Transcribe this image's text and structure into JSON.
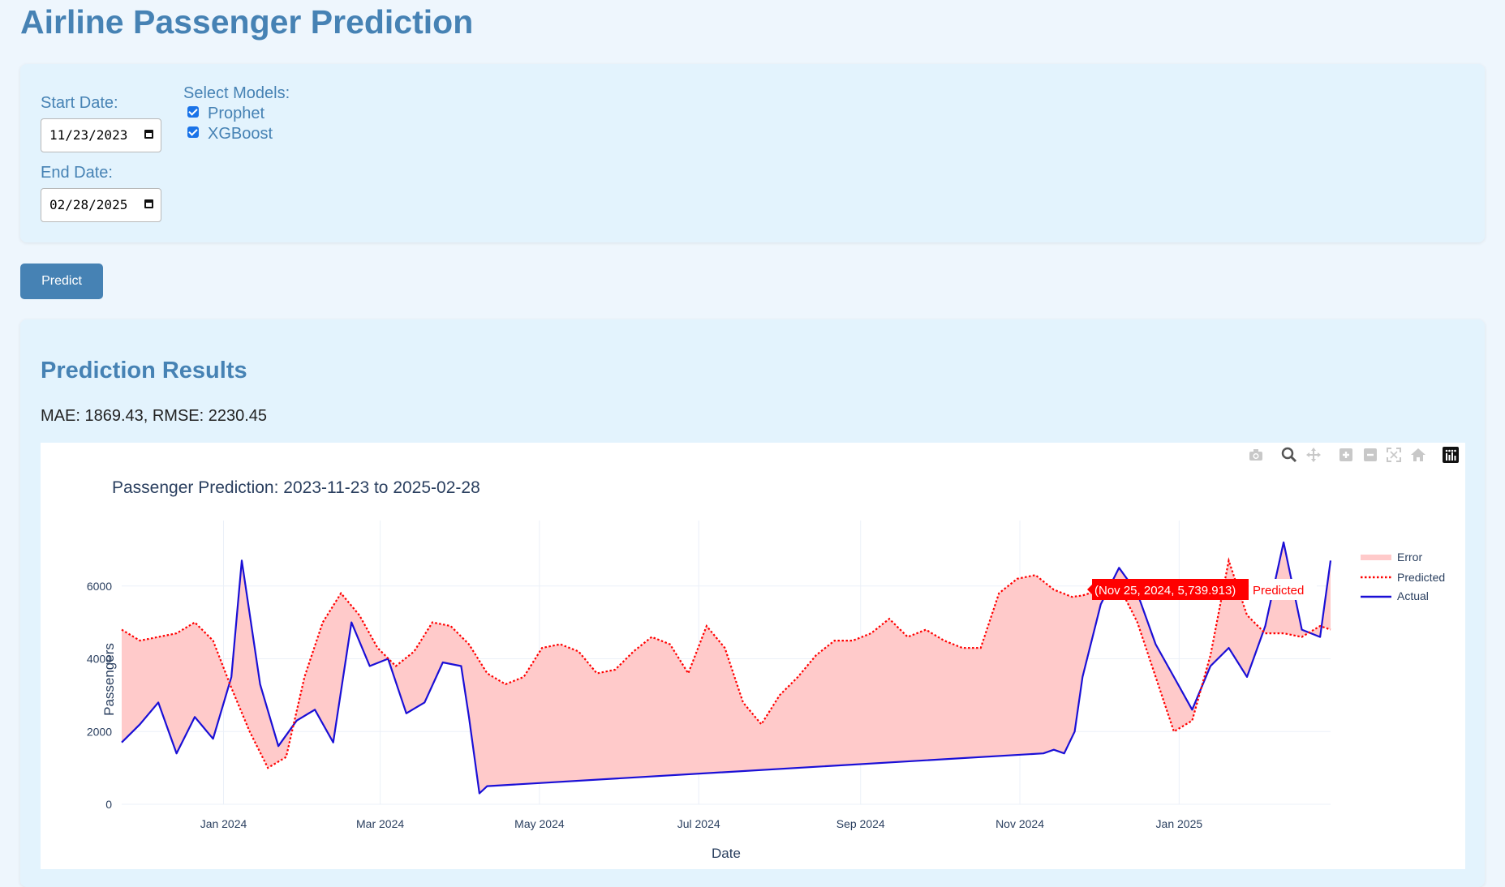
{
  "page": {
    "title": "Airline Passenger Prediction"
  },
  "controls": {
    "start_label": "Start Date:",
    "start_value": "11/23/2023",
    "end_label": "End Date:",
    "end_value": "02/28/2025",
    "models_label": "Select Models:",
    "models": [
      {
        "label": "Prophet",
        "checked": true
      },
      {
        "label": "XGBoost",
        "checked": true
      }
    ],
    "predict_label": "Predict"
  },
  "results": {
    "heading": "Prediction Results",
    "metrics": "MAE: 1869.43, RMSE: 2230.45"
  },
  "toolbar": {
    "icons": [
      "camera-icon",
      "zoom-icon",
      "pan-icon",
      "zoom-in-icon",
      "zoom-out-icon",
      "autoscale-icon",
      "reset-axes-icon",
      "plotly-logo-icon"
    ]
  },
  "tooltip": {
    "text": "(Nov 25, 2024, 5,739.913)",
    "series": "Predicted"
  },
  "chart_data": {
    "type": "line",
    "title": "Passenger Prediction: 2023-11-23 to 2025-02-28",
    "xlabel": "Date",
    "ylabel": "Passengers",
    "x_range": [
      "2023-11-23",
      "2025-02-28"
    ],
    "ylim": [
      0,
      7800
    ],
    "x_ticks": [
      {
        "date": "2024-01-01",
        "label": "Jan 2024"
      },
      {
        "date": "2024-03-01",
        "label": "Mar 2024"
      },
      {
        "date": "2024-05-01",
        "label": "May 2024"
      },
      {
        "date": "2024-07-01",
        "label": "Jul 2024"
      },
      {
        "date": "2024-09-01",
        "label": "Sep 2024"
      },
      {
        "date": "2024-11-01",
        "label": "Nov 2024"
      },
      {
        "date": "2025-01-01",
        "label": "Jan 2025"
      }
    ],
    "y_ticks": [
      0,
      2000,
      4000,
      6000
    ],
    "grid": true,
    "legend_position": "right",
    "colors": {
      "error": "#ffcaca",
      "predicted": "#ff0000",
      "actual": "#1a0fd6"
    },
    "series": [
      {
        "name": "Error",
        "style": "fill between Predicted and Actual",
        "values": []
      },
      {
        "name": "Predicted",
        "style": "dotted",
        "points": [
          [
            "2023-11-23",
            4800
          ],
          [
            "2023-11-30",
            4500
          ],
          [
            "2023-12-07",
            4600
          ],
          [
            "2023-12-14",
            4700
          ],
          [
            "2023-12-21",
            5000
          ],
          [
            "2023-12-28",
            4500
          ],
          [
            "2024-01-04",
            3200
          ],
          [
            "2024-01-11",
            2000
          ],
          [
            "2024-01-18",
            1000
          ],
          [
            "2024-01-25",
            1300
          ],
          [
            "2024-02-01",
            3500
          ],
          [
            "2024-02-08",
            5000
          ],
          [
            "2024-02-15",
            5800
          ],
          [
            "2024-02-22",
            5200
          ],
          [
            "2024-02-29",
            4300
          ],
          [
            "2024-03-07",
            3800
          ],
          [
            "2024-03-14",
            4200
          ],
          [
            "2024-03-21",
            5000
          ],
          [
            "2024-03-28",
            4900
          ],
          [
            "2024-04-04",
            4400
          ],
          [
            "2024-04-11",
            3600
          ],
          [
            "2024-04-18",
            3300
          ],
          [
            "2024-04-25",
            3500
          ],
          [
            "2024-05-02",
            4300
          ],
          [
            "2024-05-09",
            4400
          ],
          [
            "2024-05-16",
            4200
          ],
          [
            "2024-05-23",
            3600
          ],
          [
            "2024-05-30",
            3700
          ],
          [
            "2024-06-06",
            4200
          ],
          [
            "2024-06-13",
            4600
          ],
          [
            "2024-06-20",
            4400
          ],
          [
            "2024-06-27",
            3600
          ],
          [
            "2024-07-04",
            4900
          ],
          [
            "2024-07-11",
            4300
          ],
          [
            "2024-07-18",
            2800
          ],
          [
            "2024-07-25",
            2200
          ],
          [
            "2024-08-01",
            3000
          ],
          [
            "2024-08-08",
            3500
          ],
          [
            "2024-08-15",
            4100
          ],
          [
            "2024-08-22",
            4500
          ],
          [
            "2024-08-29",
            4500
          ],
          [
            "2024-09-05",
            4700
          ],
          [
            "2024-09-12",
            5100
          ],
          [
            "2024-09-19",
            4600
          ],
          [
            "2024-09-26",
            4800
          ],
          [
            "2024-10-03",
            4500
          ],
          [
            "2024-10-10",
            4300
          ],
          [
            "2024-10-17",
            4300
          ],
          [
            "2024-10-24",
            5800
          ],
          [
            "2024-10-31",
            6200
          ],
          [
            "2024-11-07",
            6300
          ],
          [
            "2024-11-14",
            5900
          ],
          [
            "2024-11-21",
            5700
          ],
          [
            "2024-11-25",
            5740
          ],
          [
            "2024-12-02",
            5900
          ],
          [
            "2024-12-09",
            6000
          ],
          [
            "2024-12-16",
            5000
          ],
          [
            "2024-12-23",
            3500
          ],
          [
            "2024-12-30",
            2000
          ],
          [
            "2025-01-06",
            2300
          ],
          [
            "2025-01-13",
            4100
          ],
          [
            "2025-01-20",
            6700
          ],
          [
            "2025-01-27",
            5200
          ],
          [
            "2025-02-03",
            4700
          ],
          [
            "2025-02-10",
            4700
          ],
          [
            "2025-02-17",
            4600
          ],
          [
            "2025-02-24",
            4900
          ],
          [
            "2025-02-28",
            4800
          ]
        ]
      },
      {
        "name": "Actual",
        "style": "solid",
        "points": [
          [
            "2023-11-23",
            1700
          ],
          [
            "2023-11-30",
            2200
          ],
          [
            "2023-12-07",
            2800
          ],
          [
            "2023-12-14",
            1400
          ],
          [
            "2023-12-21",
            2400
          ],
          [
            "2023-12-28",
            1800
          ],
          [
            "2024-01-04",
            3500
          ],
          [
            "2024-01-08",
            6700
          ],
          [
            "2024-01-15",
            3300
          ],
          [
            "2024-01-22",
            1600
          ],
          [
            "2024-01-29",
            2300
          ],
          [
            "2024-02-05",
            2600
          ],
          [
            "2024-02-12",
            1700
          ],
          [
            "2024-02-19",
            5000
          ],
          [
            "2024-02-26",
            3800
          ],
          [
            "2024-03-04",
            4000
          ],
          [
            "2024-03-11",
            2500
          ],
          [
            "2024-03-18",
            2800
          ],
          [
            "2024-03-25",
            3900
          ],
          [
            "2024-04-01",
            3800
          ],
          [
            "2024-04-04",
            2400
          ],
          [
            "2024-04-08",
            300
          ],
          [
            "2024-04-11",
            500
          ],
          [
            "2024-11-10",
            1400
          ],
          [
            "2024-11-14",
            1500
          ],
          [
            "2024-11-18",
            1400
          ],
          [
            "2024-11-22",
            2000
          ],
          [
            "2024-11-25",
            3500
          ],
          [
            "2024-12-02",
            5500
          ],
          [
            "2024-12-09",
            6500
          ],
          [
            "2024-12-16",
            5800
          ],
          [
            "2024-12-23",
            4400
          ],
          [
            "2024-12-30",
            3500
          ],
          [
            "2025-01-06",
            2600
          ],
          [
            "2025-01-13",
            3800
          ],
          [
            "2025-01-20",
            4300
          ],
          [
            "2025-01-27",
            3500
          ],
          [
            "2025-02-03",
            4900
          ],
          [
            "2025-02-10",
            7200
          ],
          [
            "2025-02-17",
            4800
          ],
          [
            "2025-02-24",
            4600
          ],
          [
            "2025-02-28",
            6700
          ]
        ]
      }
    ]
  }
}
